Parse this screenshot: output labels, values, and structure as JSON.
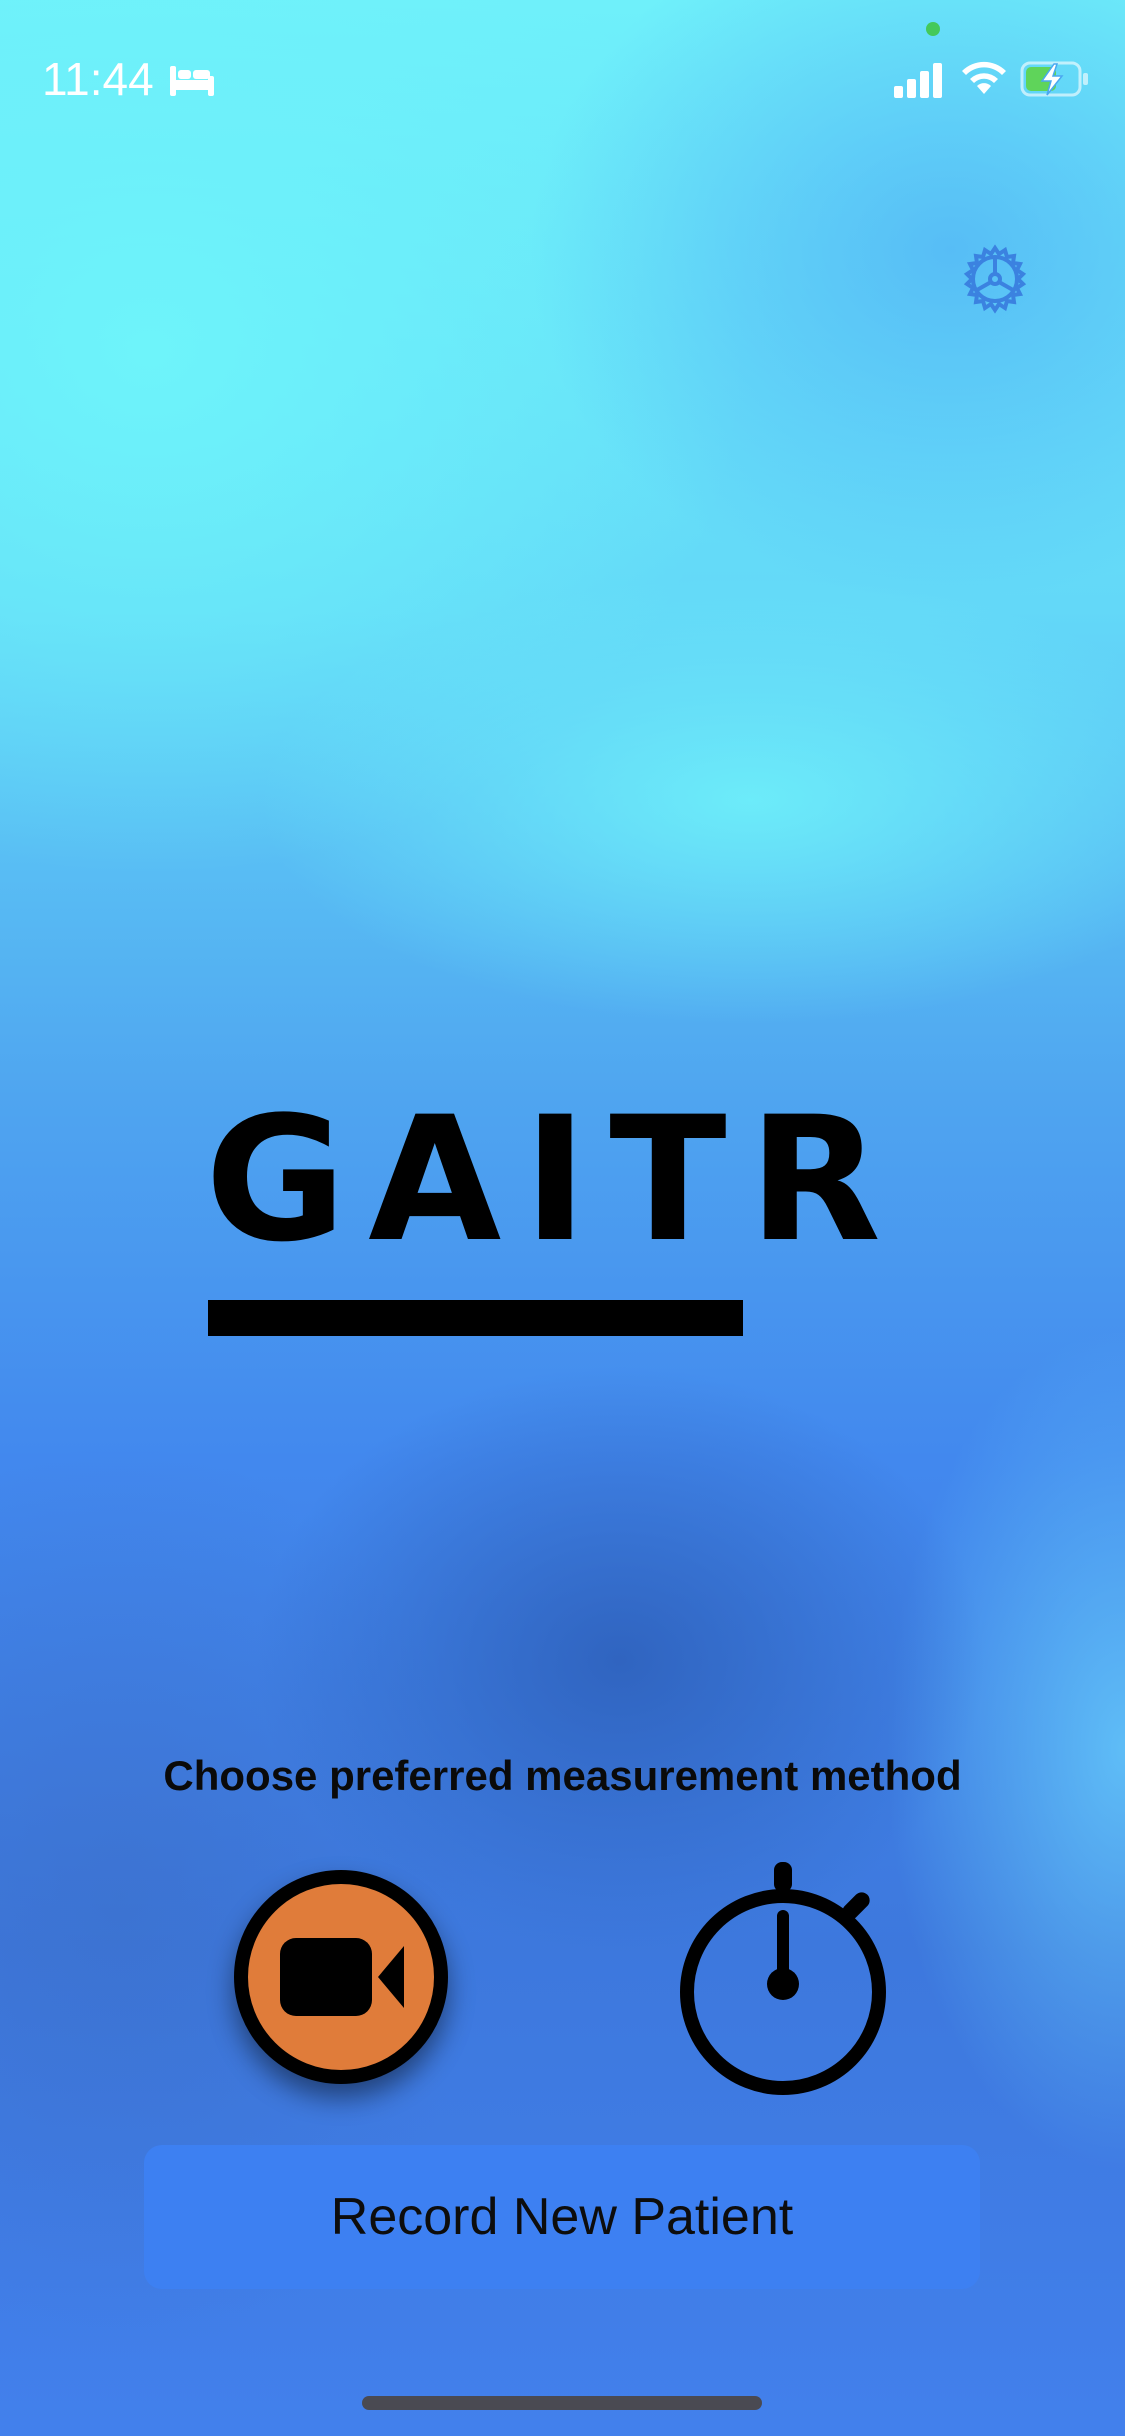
{
  "status_bar": {
    "time": "11:44",
    "icons": [
      "bed-icon",
      "signal-icon",
      "wifi-icon",
      "battery-charging-icon"
    ]
  },
  "settings": {
    "icon": "gear-icon",
    "color": "#3b82e0"
  },
  "logo": {
    "text": "GAITR"
  },
  "prompt": "Choose preferred measurement method",
  "methods": [
    {
      "name": "video",
      "icon": "video-camera-icon",
      "color": "#e07c3a",
      "selected": true
    },
    {
      "name": "stopwatch",
      "icon": "stopwatch-icon",
      "selected": false
    }
  ],
  "record_button": {
    "label": "Record New Patient",
    "color": "#3d80f2"
  }
}
